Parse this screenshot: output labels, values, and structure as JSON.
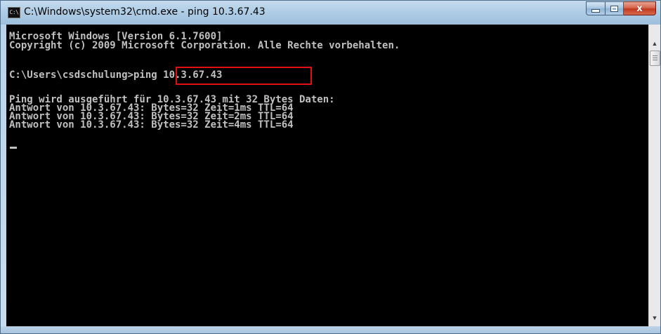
{
  "window": {
    "title": "C:\\Windows\\system32\\cmd.exe - ping  10.3.67.43",
    "app_icon_text": "C:\\",
    "buttons": {
      "minimize": "minimize",
      "maximize": "maximize",
      "close": "x"
    }
  },
  "console": {
    "lines": [
      "Microsoft Windows [Version 6.1.7600]",
      "Copyright (c) 2009 Microsoft Corporation. Alle Rechte vorbehalten.",
      "",
      "C:\\Users\\csdschulung>ping 10.3.67.43",
      "",
      "Ping wird ausgeführt für 10.3.67.43 mit 32 Bytes Daten:",
      "Antwort von 10.3.67.43: Bytes=32 Zeit=1ms TTL=64",
      "Antwort von 10.3.67.43: Bytes=32 Zeit=2ms TTL=64",
      "Antwort von 10.3.67.43: Bytes=32 Zeit=4ms TTL=64"
    ],
    "text_color": "#c0c0c0",
    "background_color": "#000000",
    "highlight_color": "#e01010"
  },
  "scrollbar": {
    "up_icon": "arrow-up-icon",
    "down_icon": "arrow-down-icon"
  }
}
